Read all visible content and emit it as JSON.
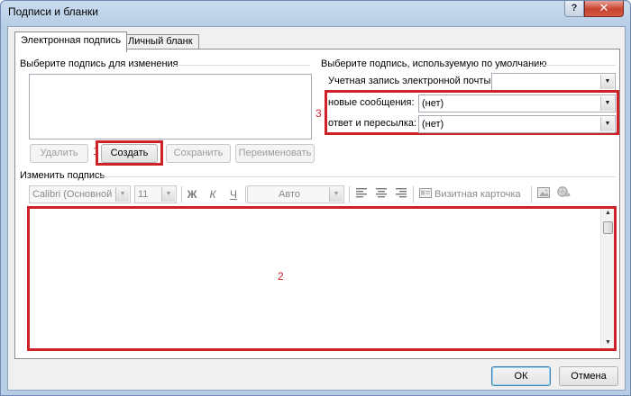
{
  "window": {
    "title": "Подписи и бланки",
    "help_label": "?",
    "close_label": "✕"
  },
  "tabs": [
    {
      "label": "Электронная подпись",
      "active": true
    },
    {
      "label": "Личный бланк",
      "active": false
    }
  ],
  "left_section": {
    "heading": "Выберите подпись для изменения",
    "buttons": {
      "delete": "Удалить",
      "create": "Создать",
      "save": "Сохранить",
      "rename": "Переименовать"
    }
  },
  "right_section": {
    "heading": "Выберите подпись, используемую по умолчанию",
    "account_label": "Учетная запись электронной почты:",
    "account_value": "",
    "new_messages_label": "новые сообщения:",
    "new_messages_value": "(нет)",
    "reply_label": "ответ и пересылка:",
    "reply_value": "(нет)"
  },
  "edit_section": {
    "heading": "Изменить подпись",
    "font_name": "Calibri (Основной тек",
    "font_size": "11",
    "bold": "Ж",
    "italic": "К",
    "underline": "Ч",
    "color_value": "Авто",
    "business_card_label": "Визитная карточка",
    "icons": [
      "align-left-icon",
      "align-center-icon",
      "align-right-icon",
      "business-card-icon",
      "insert-picture-icon",
      "hyperlink-icon"
    ]
  },
  "annotations": {
    "one": "1",
    "two": "2",
    "three": "3"
  },
  "footer": {
    "ok": "ОК",
    "cancel": "Отмена"
  },
  "colors": {
    "highlight": "#cc2228",
    "title_bar": "#b7cde6",
    "default_button_border": "#3c7fb1"
  }
}
